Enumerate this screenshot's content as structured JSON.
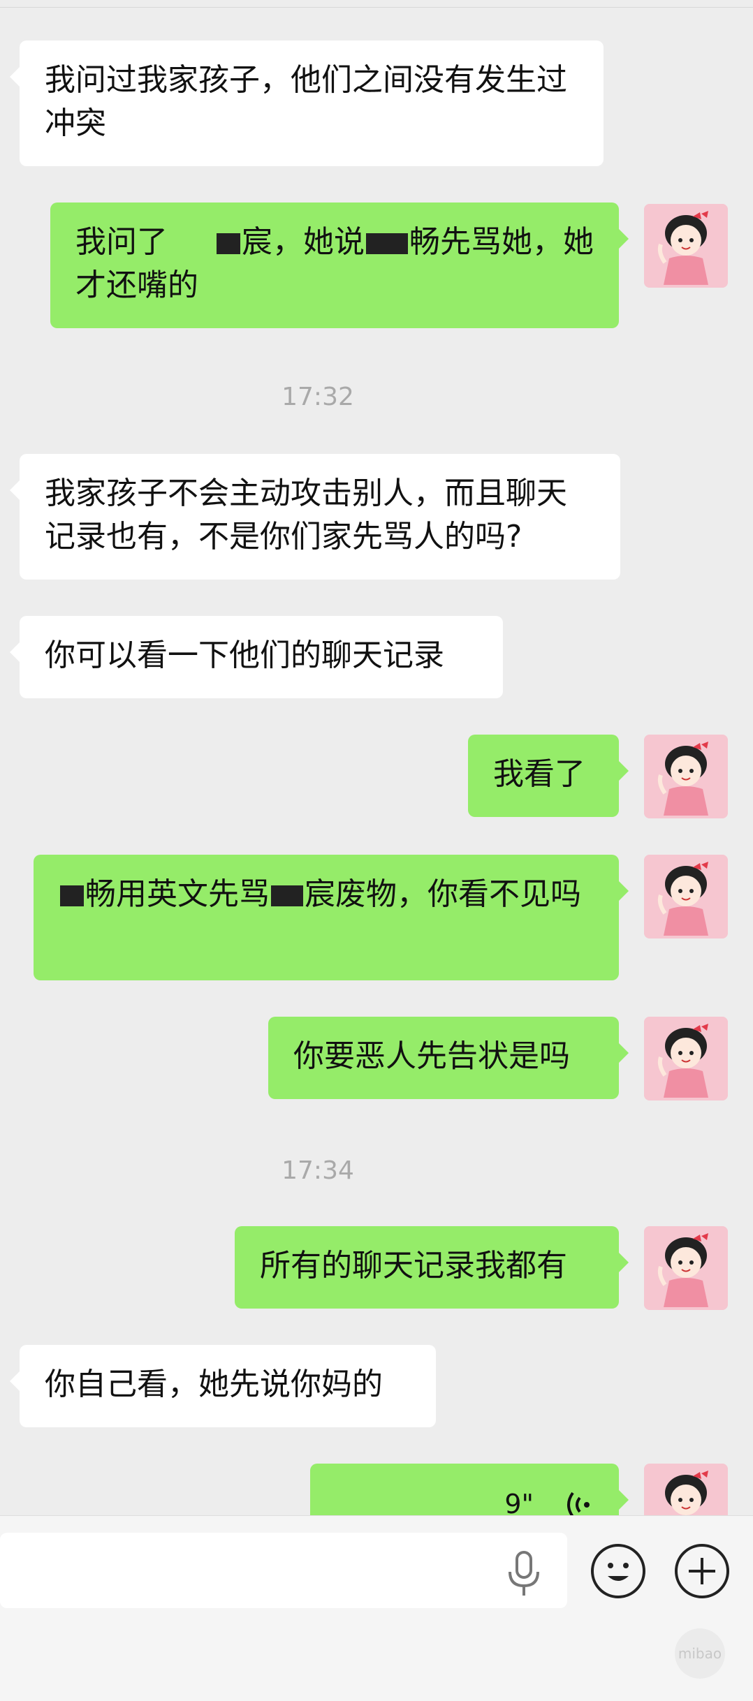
{
  "messages": [
    {
      "side": "left",
      "text": "我问过我家孩子，他们之间没有发生过冲突"
    },
    {
      "side": "right",
      "text_a": "我问了",
      "text_b": "宸，她说",
      "text_c": "畅先骂她，她才还嘴的"
    },
    {
      "side": "time",
      "text": "17:32"
    },
    {
      "side": "left",
      "text": "我家孩子不会主动攻击别人，而且聊天记录也有，不是你们家先骂人的吗?"
    },
    {
      "side": "left",
      "text": "你可以看一下他们的聊天记录"
    },
    {
      "side": "right",
      "text": "我看了"
    },
    {
      "side": "right",
      "text_a": "畅用英文先骂",
      "text_b": "宸废物，你看不见吗"
    },
    {
      "side": "right",
      "text": "你要恶人先告状是吗"
    },
    {
      "side": "time",
      "text": "17:34"
    },
    {
      "side": "right",
      "text": "所有的聊天记录我都有"
    },
    {
      "side": "left",
      "text": "你自己看，她先说你妈的"
    },
    {
      "side": "right",
      "voice_duration": "9\""
    }
  ],
  "input": {
    "placeholder": "",
    "mic": "microphone-icon",
    "emoji": "emoji-icon",
    "plus": "plus-icon"
  },
  "watermark": {
    "text": "mibao"
  },
  "colors": {
    "background": "#ededed",
    "bubble_right": "#95ec69",
    "bubble_left": "#ffffff",
    "timestamp": "#a9a9a9"
  }
}
